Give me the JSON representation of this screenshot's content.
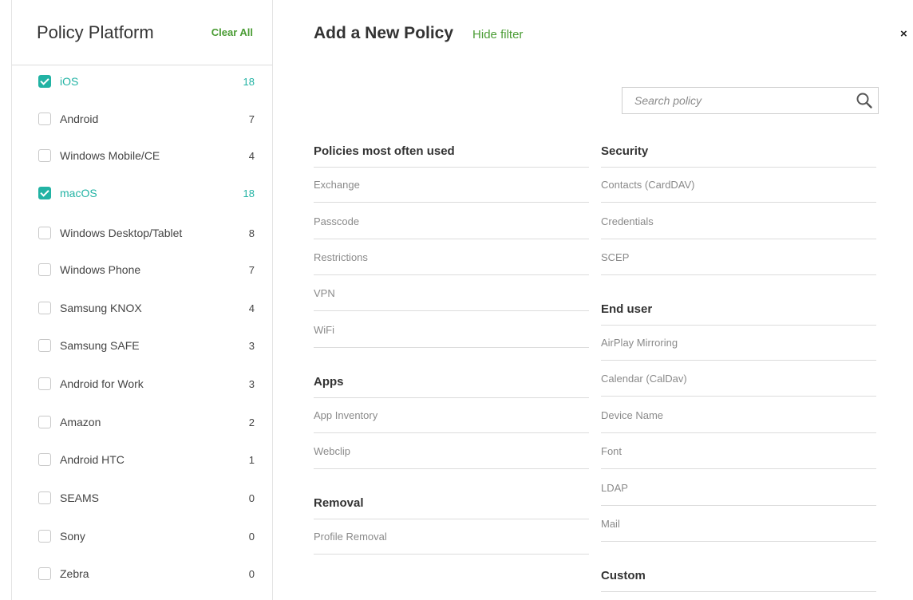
{
  "sidebar": {
    "title": "Policy Platform",
    "clear_all": "Clear All",
    "platforms": [
      {
        "label": "iOS",
        "count": "18",
        "checked": true
      },
      {
        "label": "Android",
        "count": "7",
        "checked": false
      },
      {
        "label": "Windows Mobile/CE",
        "count": "4",
        "checked": false
      },
      {
        "label": "macOS",
        "count": "18",
        "checked": true
      },
      {
        "label": "Windows Desktop/Tablet",
        "count": "8",
        "checked": false
      },
      {
        "label": "Windows Phone",
        "count": "7",
        "checked": false
      },
      {
        "label": "Samsung KNOX",
        "count": "4",
        "checked": false
      },
      {
        "label": "Samsung SAFE",
        "count": "3",
        "checked": false
      },
      {
        "label": "Android for Work",
        "count": "3",
        "checked": false
      },
      {
        "label": "Amazon",
        "count": "2",
        "checked": false
      },
      {
        "label": "Android HTC",
        "count": "1",
        "checked": false
      },
      {
        "label": "SEAMS",
        "count": "0",
        "checked": false
      },
      {
        "label": "Sony",
        "count": "0",
        "checked": false
      },
      {
        "label": "Zebra",
        "count": "0",
        "checked": false
      }
    ]
  },
  "header": {
    "title": "Add a New Policy",
    "hide_filter": "Hide filter",
    "close": "×"
  },
  "search": {
    "placeholder": "Search policy",
    "value": ""
  },
  "policies": {
    "most_used": {
      "title": "Policies most often used",
      "items": [
        "Exchange",
        "Passcode",
        "Restrictions",
        "VPN",
        "WiFi"
      ]
    },
    "apps": {
      "title": "Apps",
      "items": [
        "App Inventory",
        "Webclip"
      ]
    },
    "removal": {
      "title": "Removal",
      "items": [
        "Profile Removal"
      ]
    },
    "security": {
      "title": "Security",
      "items": [
        "Contacts (CardDAV)",
        "Credentials",
        "SCEP"
      ]
    },
    "end_user": {
      "title": "End user",
      "items": [
        "AirPlay Mirroring",
        "Calendar (CalDav)",
        "Device Name",
        "Font",
        "LDAP",
        "Mail"
      ]
    },
    "custom": {
      "title": "Custom"
    }
  },
  "colors": {
    "accent_teal": "#22b3a4",
    "link_green": "#4a9c34"
  },
  "icons": [
    "search-icon",
    "close-icon",
    "checkbox-checked-icon"
  ]
}
